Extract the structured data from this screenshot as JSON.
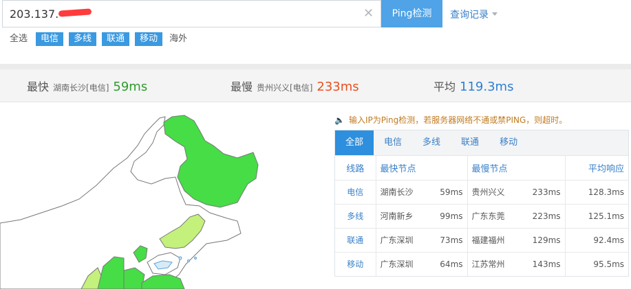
{
  "search": {
    "ip_value": "203.137.",
    "ping_button": "Ping检测",
    "history_label": "查询记录"
  },
  "filters": [
    {
      "label": "全选",
      "active": false
    },
    {
      "label": "电信",
      "active": true
    },
    {
      "label": "多线",
      "active": true
    },
    {
      "label": "联通",
      "active": true
    },
    {
      "label": "移动",
      "active": true
    },
    {
      "label": "海外",
      "active": false
    }
  ],
  "stats": {
    "fastest": {
      "label": "最快",
      "node": "湖南长沙[电信]",
      "value": "59ms",
      "color": "#2e9c2e"
    },
    "slowest": {
      "label": "最慢",
      "node": "贵州兴义[电信]",
      "value": "233ms",
      "color": "#e8501f"
    },
    "average": {
      "label": "平均",
      "value": "119.3ms",
      "color": "#2d7fd3"
    }
  },
  "notice": "输入IP为Ping检测，若服务器网络不通或禁PING，则超时。",
  "tabs": [
    "全部",
    "电信",
    "多线",
    "联通",
    "移动"
  ],
  "table": {
    "headers": [
      "线路",
      "最快节点",
      "最慢节点",
      "平均响应"
    ],
    "rows": [
      {
        "line": "电信",
        "fast_node": "湖南长沙",
        "fast_ms": "59ms",
        "slow_node": "贵州兴义",
        "slow_ms": "233ms",
        "avg": "128.3ms"
      },
      {
        "line": "多线",
        "fast_node": "河南新乡",
        "fast_ms": "99ms",
        "slow_node": "广东东莞",
        "slow_ms": "223ms",
        "avg": "125.1ms"
      },
      {
        "line": "联通",
        "fast_node": "广东深圳",
        "fast_ms": "73ms",
        "slow_node": "福建福州",
        "slow_ms": "129ms",
        "avg": "92.4ms"
      },
      {
        "line": "移动",
        "fast_node": "广东深圳",
        "fast_ms": "64ms",
        "slow_node": "江苏常州",
        "slow_ms": "143ms",
        "avg": "95.5ms"
      }
    ]
  },
  "colors": {
    "accent": "#2d8fdd",
    "map_dark_green": "#46dd46",
    "map_light_green": "#c4f07c"
  }
}
